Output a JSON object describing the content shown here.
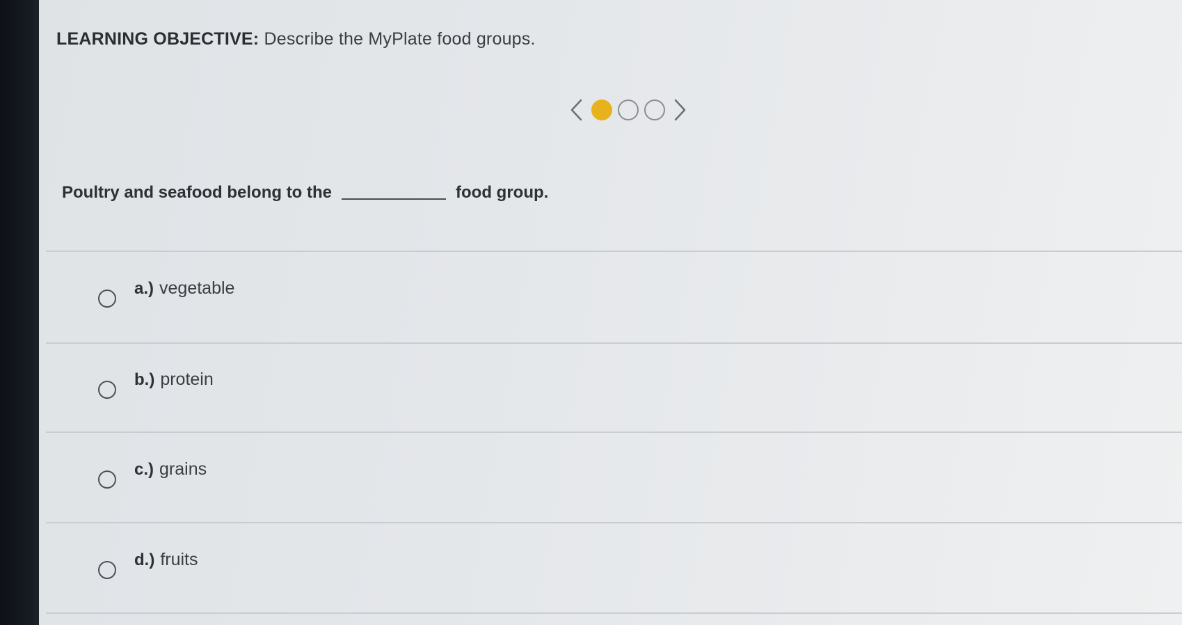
{
  "objective": {
    "label": "LEARNING OBJECTIVE:",
    "text": "Describe the MyPlate food groups."
  },
  "pager": {
    "prev_icon": "chevron-left-icon",
    "next_icon": "chevron-right-icon",
    "current_page": 1,
    "total_pages": 3,
    "active_color": "#e8b21c"
  },
  "question": {
    "before_blank": "Poultry and seafood belong to the",
    "after_blank": "food group."
  },
  "options": [
    {
      "letter": "a.)",
      "text": "vegetable"
    },
    {
      "letter": "b.)",
      "text": "protein"
    },
    {
      "letter": "c.)",
      "text": "grains"
    },
    {
      "letter": "d.)",
      "text": "fruits"
    }
  ]
}
